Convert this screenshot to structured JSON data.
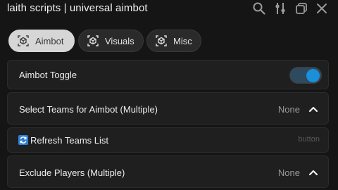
{
  "window": {
    "title": "laith scripts | universal aimbot",
    "icons": [
      "search-icon",
      "settings-sliders-icon",
      "minimize-window-icon",
      "close-icon"
    ]
  },
  "tabs": [
    {
      "label": "Aimbot",
      "icon": "cube-icon",
      "active": true
    },
    {
      "label": "Visuals",
      "icon": "cube-icon",
      "active": false
    },
    {
      "label": "Misc",
      "icon": "cube-icon",
      "active": false
    }
  ],
  "controls": {
    "aimbot_toggle": {
      "label": "Aimbot Toggle",
      "state": "on"
    },
    "select_teams": {
      "label": "Select Teams for Aimbot (Multiple)",
      "value": "None"
    },
    "refresh_teams": {
      "label": "Refresh Teams List",
      "hint": "button",
      "icon": "refresh-icon"
    },
    "exclude_players": {
      "label": "Exclude Players (Multiple)",
      "value": "None"
    }
  },
  "colors": {
    "background": "#151515",
    "accent": "#1c8fd9",
    "active_tab": "#d6d6d6"
  }
}
